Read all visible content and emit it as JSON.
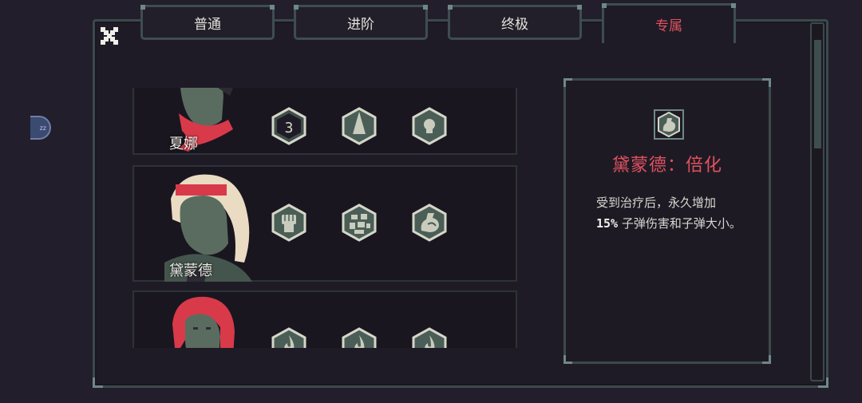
{
  "tabs": [
    {
      "label": "普通",
      "active": false
    },
    {
      "label": "进阶",
      "active": false
    },
    {
      "label": "终极",
      "active": false
    },
    {
      "label": "专属",
      "active": true
    }
  ],
  "characters": [
    {
      "name": "夏娜",
      "perks": [
        "number-3-icon",
        "spike-icon",
        "bulb-icon"
      ]
    },
    {
      "name": "黛蒙德",
      "perks": [
        "fist-icon",
        "rubble-icon",
        "arm-muscle-icon"
      ]
    },
    {
      "name": "",
      "perks": [
        "flame-icon",
        "flame-icon",
        "flame-icon"
      ]
    }
  ],
  "detail": {
    "icon": "arm-muscle-icon",
    "title": "黛蒙德：倍化",
    "desc_pre": "受到治疗后，永久增加",
    "desc_value": "15%",
    "desc_post": " 子弹伤害和子弹大小。"
  },
  "side_knob": {
    "label": "zz"
  },
  "colors": {
    "accent": "#e05260",
    "frame": "#3b4a4c",
    "perk_fill": "#4a5e57",
    "background": "#221e2b"
  }
}
